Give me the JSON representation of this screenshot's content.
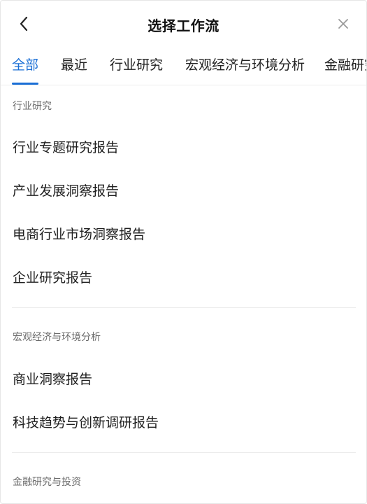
{
  "header": {
    "title": "选择工作流",
    "back_icon": "chevron-left-icon",
    "close_icon": "close-icon"
  },
  "tabs": [
    {
      "label": "全部",
      "active": true
    },
    {
      "label": "最近",
      "active": false
    },
    {
      "label": "行业研究",
      "active": false
    },
    {
      "label": "宏观经济与环境分析",
      "active": false
    },
    {
      "label": "金融研究",
      "active": false
    }
  ],
  "sections": [
    {
      "title": "行业研究",
      "items": [
        "行业专题研究报告",
        "产业发展洞察报告",
        "电商行业市场洞察报告",
        "企业研究报告"
      ]
    },
    {
      "title": "宏观经济与环境分析",
      "items": [
        "商业洞察报告",
        "科技趋势与创新调研报告"
      ]
    },
    {
      "title": "金融研究与投资",
      "items": []
    }
  ],
  "colors": {
    "accent": "#1a6fd6",
    "text": "#1f1f1f",
    "muted": "#6b6b6b",
    "divider": "#ececec"
  }
}
